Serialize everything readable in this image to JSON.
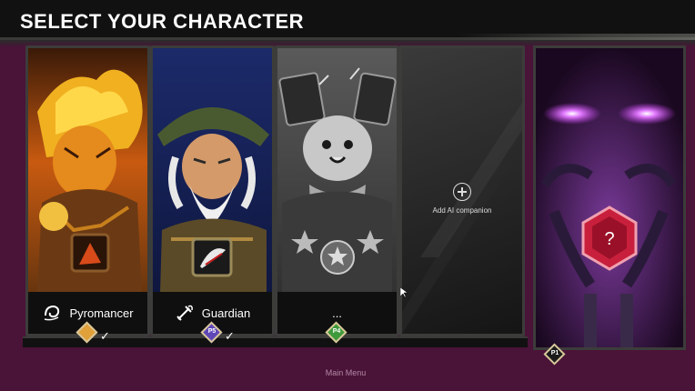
{
  "header": {
    "title": "SELECT YOUR CHARACTER"
  },
  "characters": [
    {
      "name": "Pyromancer",
      "icon": "swirl-icon",
      "badge": "",
      "badge_color": "#e0a03a",
      "checked": "✓"
    },
    {
      "name": "Guardian",
      "icon": "sword-icon",
      "badge": "P5",
      "badge_color": "#5f47b8",
      "checked": "✓"
    },
    {
      "name": "...",
      "icon": "",
      "badge": "P4",
      "badge_color": "#3e9a3b",
      "checked": ""
    }
  ],
  "ai_slot": {
    "label": "Add AI companion"
  },
  "player_slot": {
    "badge": "P1",
    "badge_color": "#1b1b1b",
    "symbol": "?"
  },
  "footer": {
    "main_menu": "Main Menu"
  },
  "colors": {
    "background": "#4a1338",
    "title_bar": "#111111",
    "card_border": "#3c3c3a",
    "eye_glow": "#c93cf0",
    "mystery_gem": "#c8203c"
  }
}
